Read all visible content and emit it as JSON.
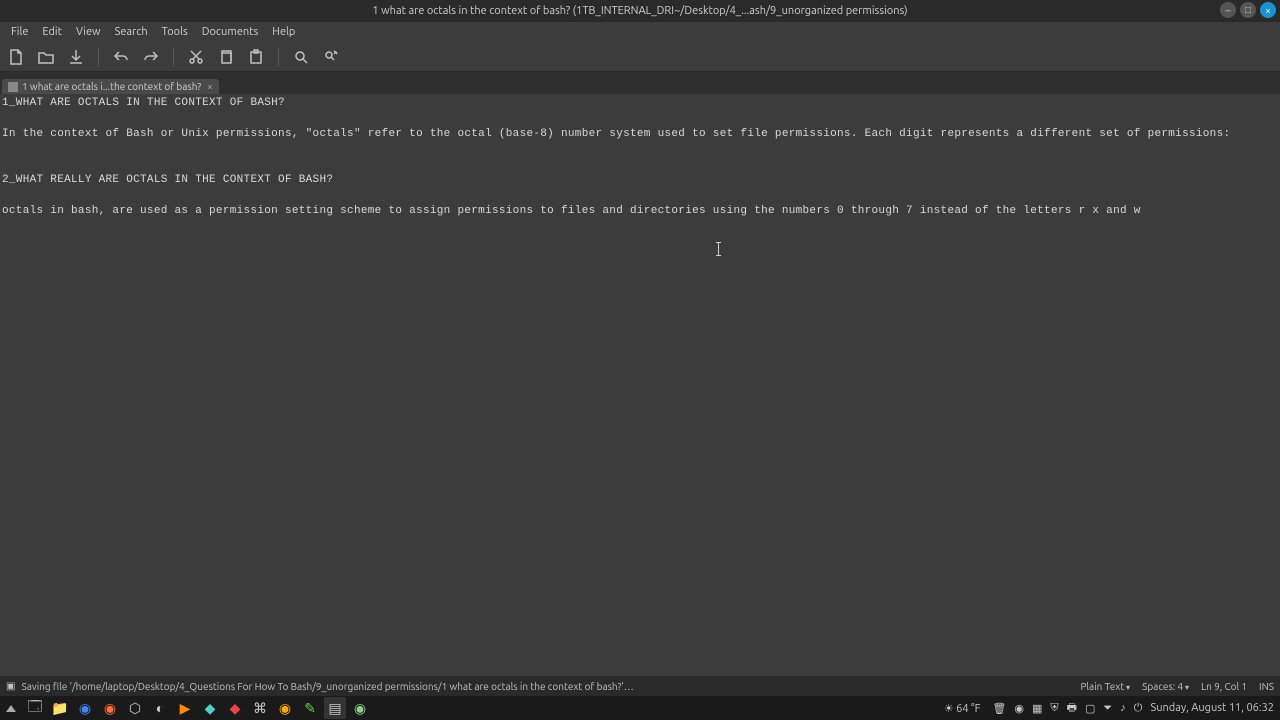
{
  "window": {
    "title": "1 what are octals in the context of bash? (1TB_INTERNAL_DRI~/Desktop/4_...ash/9_unorganized permissions)"
  },
  "menu": {
    "file": "File",
    "edit": "Edit",
    "view": "View",
    "search": "Search",
    "tools": "Tools",
    "documents": "Documents",
    "help": "Help"
  },
  "tab": {
    "label": "1 what are octals i...the context of bash?",
    "close": "×"
  },
  "document": {
    "lines": [
      "1_WHAT ARE OCTALS IN THE CONTEXT OF BASH?",
      "",
      "In the context of Bash or Unix permissions, \"octals\" refer to the octal (base-8) number system used to set file permissions. Each digit represents a different set of permissions:",
      "",
      "",
      "2_WHAT REALLY ARE OCTALS IN THE CONTEXT OF BASH?",
      "",
      "octals in bash, are used as a permission setting scheme to assign permissions to files and directories using the numbers 0 through 7 instead of the letters r x and w"
    ]
  },
  "status": {
    "save_msg": "Saving file '/home/laptop/Desktop/4_Questions For How To Bash/9_unorganized permissions/1 what are octals in the context of bash?'…",
    "syntax": "Plain Text",
    "spaces": "Spaces: 4",
    "position": "Ln 9, Col 1",
    "mode": "INS"
  },
  "panel": {
    "weather": "64 °F",
    "clock": "Sunday, August 11, 06:32"
  }
}
